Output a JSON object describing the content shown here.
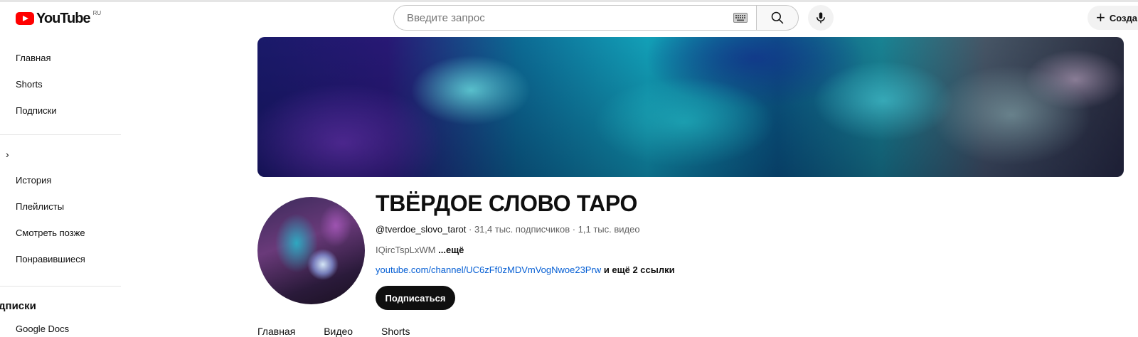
{
  "logo": {
    "text": "YouTube",
    "region": "RU"
  },
  "search": {
    "placeholder": "Введите запрос"
  },
  "header": {
    "create_label": "Созда"
  },
  "sidebar": {
    "items": [
      {
        "label": "Главная"
      },
      {
        "label": "Shorts"
      },
      {
        "label": "Подписки"
      },
      {
        "label": "История"
      },
      {
        "label": "Плейлисты"
      },
      {
        "label": "Смотреть позже"
      },
      {
        "label": "Понравившиеся"
      }
    ],
    "you_chevron": "›",
    "section_title": "дписки",
    "subscription_first": "Google Docs"
  },
  "channel": {
    "name": "ТВЁРДОЕ СЛОВО ТАРО",
    "handle": "@tverdoe_slovo_tarot",
    "stats": " · 31,4 тыс. подписчиков · 1,1 тыс. видео",
    "description": "IQircTspLxWM ",
    "more": "...ещё",
    "link": "youtube.com/channel/UC6zFf0zMDVmVogNwoe23Prw",
    "more_links": " и ещё 2 ссылки",
    "subscribe_label": "Подписаться"
  },
  "tabs": [
    "Главная",
    "Видео",
    "Shorts"
  ],
  "colors": {
    "brand": "#ff0000",
    "link": "#065fd4",
    "subscribe_bg": "#0f0f0f"
  }
}
